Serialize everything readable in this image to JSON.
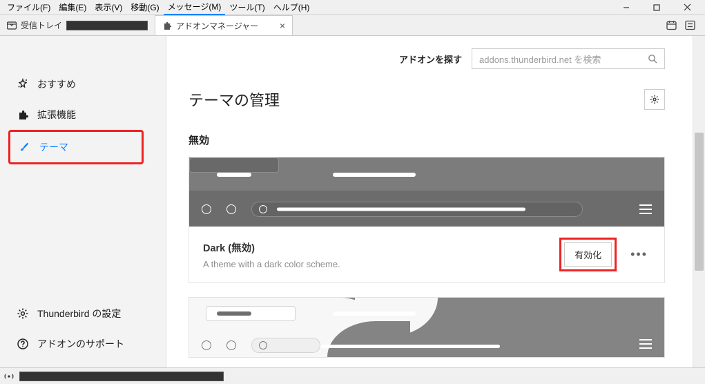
{
  "menubar": {
    "file": "ファイル(F)",
    "edit": "編集(E)",
    "view": "表示(V)",
    "go": "移動(G)",
    "message": "メッセージ(M)",
    "tools": "ツール(T)",
    "help": "ヘルプ(H)"
  },
  "tabs": {
    "inbox_label": "受信トレイ",
    "addon_label": "アドオンマネージャー"
  },
  "sidebar": {
    "recommend": "おすすめ",
    "extensions": "拡張機能",
    "themes": "テーマ",
    "settings": "Thunderbird の設定",
    "support": "アドオンのサポート"
  },
  "search": {
    "label": "アドオンを探す",
    "placeholder": "addons.thunderbird.net を検索"
  },
  "page": {
    "title": "テーマの管理",
    "section_disabled": "無効"
  },
  "themes": {
    "dark": {
      "title": "Dark (無効)",
      "desc": "A theme with a dark color scheme.",
      "enable": "有効化"
    }
  }
}
